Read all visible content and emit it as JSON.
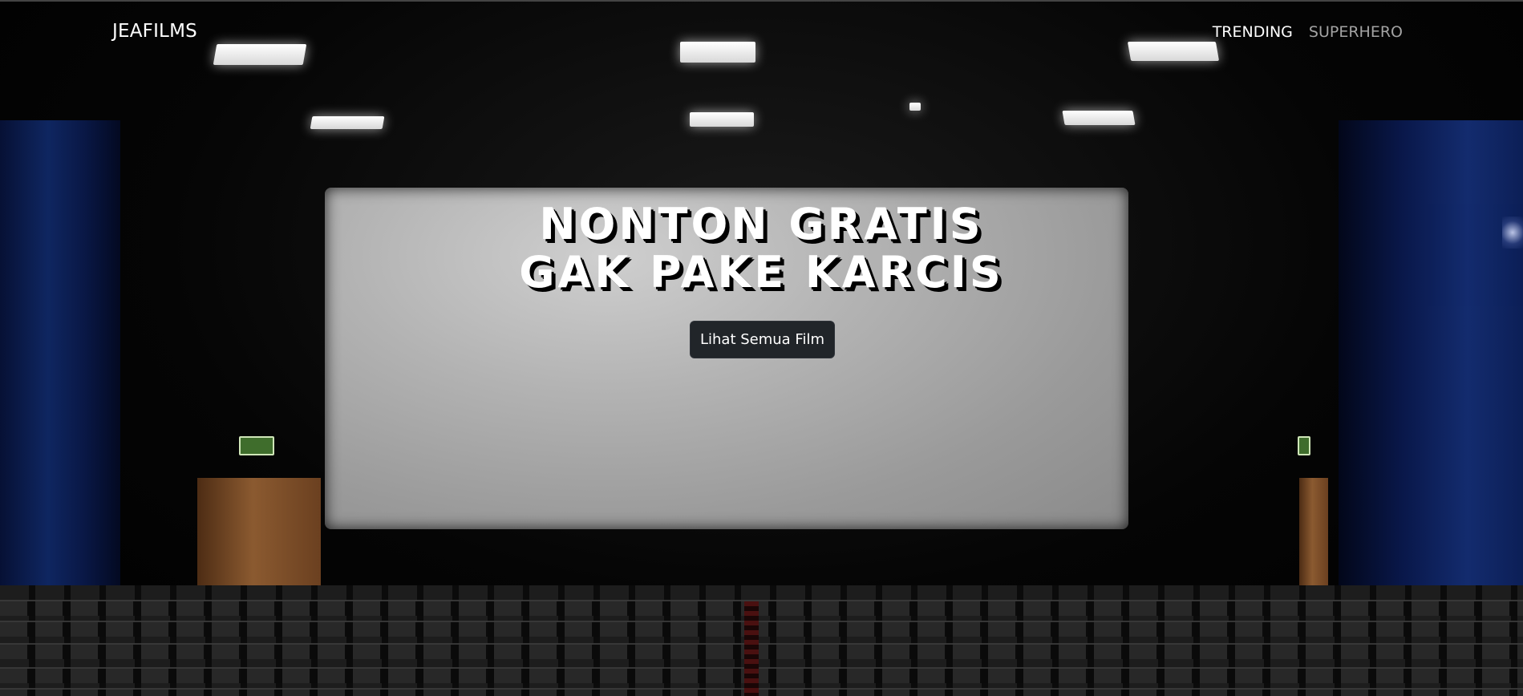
{
  "navbar": {
    "brand": "JEAFILMS",
    "links": [
      {
        "label": "TRENDING",
        "active": true
      },
      {
        "label": "SUPERHERO",
        "active": false
      }
    ]
  },
  "hero": {
    "title_line_1": "NONTON GRATIS",
    "title_line_2": "GAK PAKE KARCIS",
    "cta_label": "Lihat Semua Film"
  },
  "colors": {
    "button_bg": "#212529",
    "nav_active": "#ffffff",
    "nav_inactive": "#a3a3a3"
  }
}
